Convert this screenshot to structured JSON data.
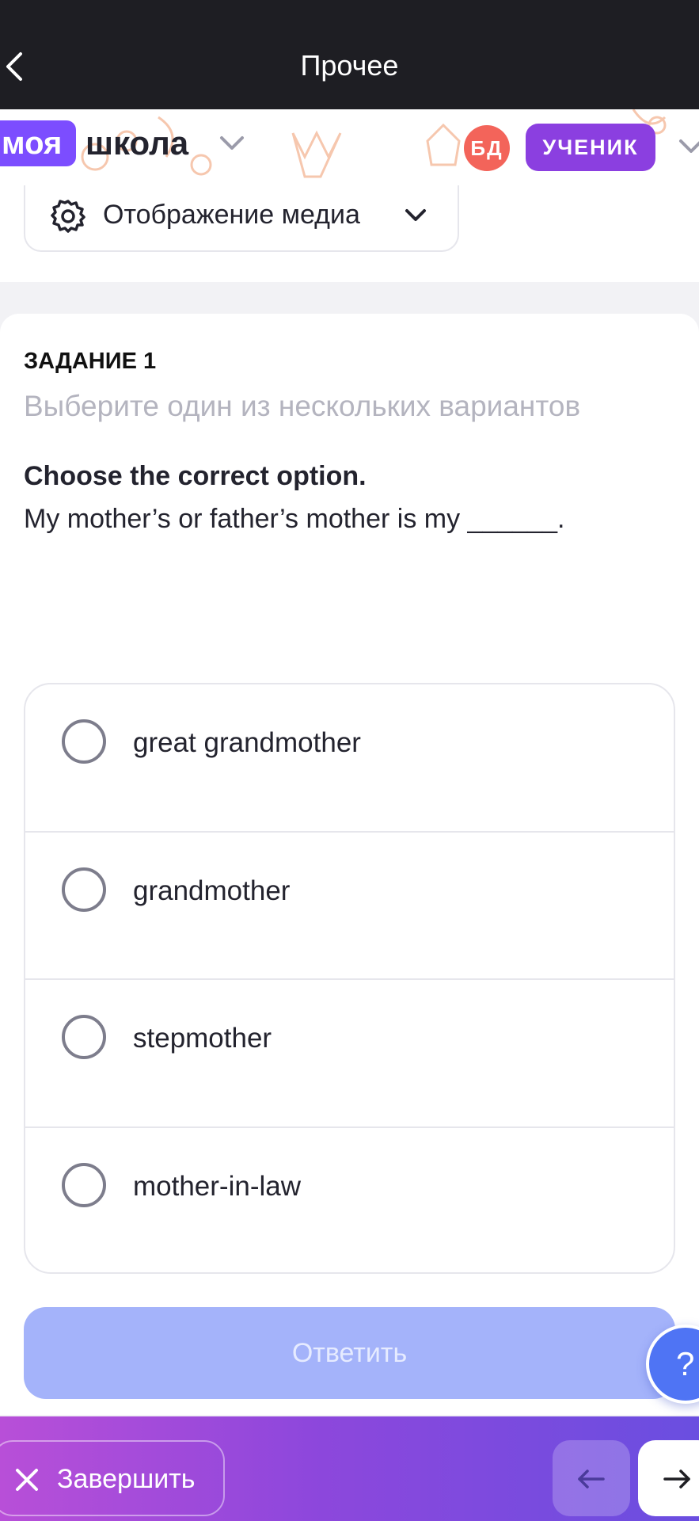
{
  "nav": {
    "title": "Прочее",
    "back_icon": "chevron-left-icon"
  },
  "brand": {
    "pill": "моя",
    "school": "школа",
    "avatar_initials": "БД",
    "role": "УЧЕНИК",
    "accent_color": "#7c4dff",
    "avatar_color": "#f3645a"
  },
  "media": {
    "label": "Отображение медиа",
    "icon": "gear-icon"
  },
  "task": {
    "number": "ЗАДАНИЕ 1",
    "hint": "Выберите один из нескольких вариантов",
    "instruction": "Choose the correct option.",
    "question": "My mother’s or father’s mother is my ______."
  },
  "options": [
    {
      "label": "great grandmother",
      "selected": false
    },
    {
      "label": "grandmother",
      "selected": false
    },
    {
      "label": "stepmother",
      "selected": false
    },
    {
      "label": "mother-in-law",
      "selected": false
    }
  ],
  "actions": {
    "answer": "Ответить",
    "help": "?",
    "finish": "Завершить"
  }
}
